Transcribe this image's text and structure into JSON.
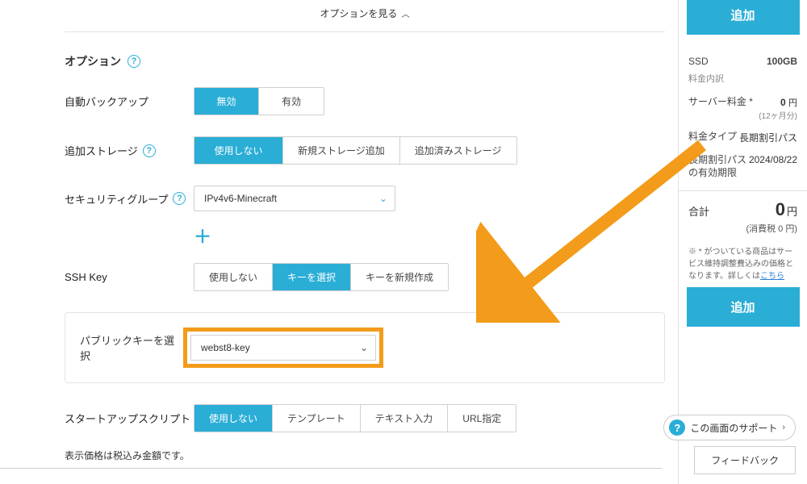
{
  "header": {
    "view_options": "オプションを見る"
  },
  "options": {
    "title": "オプション",
    "auto_backup": {
      "label": "自動バックアップ",
      "disabled": "無効",
      "enabled": "有効"
    },
    "add_storage": {
      "label": "追加ストレージ",
      "none": "使用しない",
      "new": "新規ストレージ追加",
      "existing": "追加済みストレージ"
    },
    "security_group": {
      "label": "セキュリティグループ",
      "selected": "IPv4v6-Minecraft"
    },
    "ssh_key": {
      "label": "SSH Key",
      "none": "使用しない",
      "select": "キーを選択",
      "create": "キーを新規作成"
    },
    "public_key": {
      "label": "パブリックキーを選択",
      "selected": "webst8-key"
    },
    "startup_script": {
      "label": "スタートアップスクリプト",
      "none": "使用しない",
      "template": "テンプレート",
      "text": "テキスト入力",
      "url": "URL指定"
    },
    "price_note": "表示価格は税込み金額です。"
  },
  "sidebar": {
    "add_label": "追加",
    "ssd": {
      "label": "SSD",
      "value": "100GB"
    },
    "breakdown": "料金内訳",
    "server_fee": {
      "label": "サーバー料金 *",
      "value": "0",
      "unit": "円",
      "sub": "(12ヶ月分)"
    },
    "fee_type": {
      "label": "料金タイプ",
      "value": "長期割引パス"
    },
    "pass_expiry": {
      "label": "長期割引パスの有効期限",
      "value": "2024/08/22"
    },
    "total": {
      "label": "合計",
      "value": "0",
      "unit": "円"
    },
    "tax": "(消費税 0 円)",
    "disclaimer_pre": "※ * がついている商品はサービス維持調整費込みの価格となります。詳しくは",
    "disclaimer_link": "こちら"
  },
  "floating": {
    "support": "この画面のサポート",
    "feedback": "フィードバック"
  }
}
